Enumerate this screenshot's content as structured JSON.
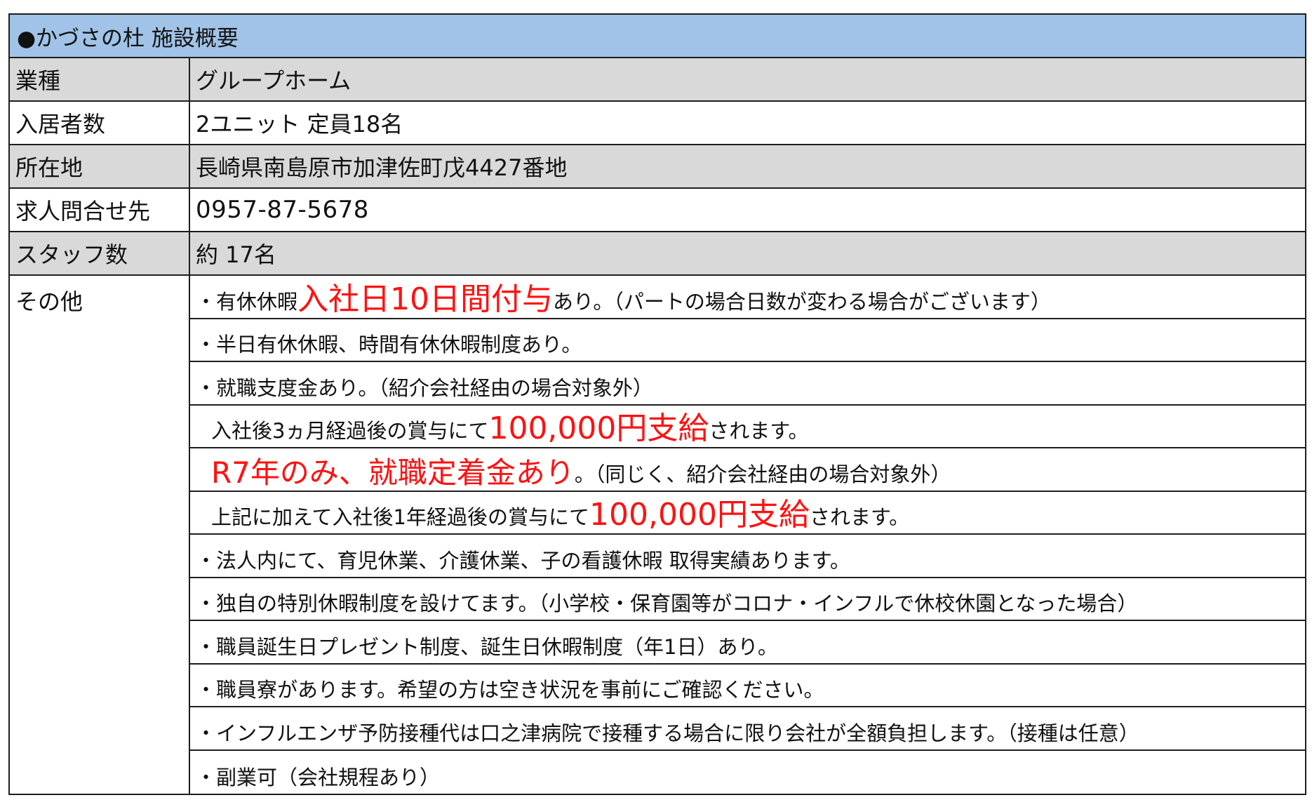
{
  "title": "●かづさの杜  施設概要",
  "rows": [
    {
      "label": "業種",
      "value": "グループホーム"
    },
    {
      "label": "入居者数",
      "value": "2ユニット  定員18名"
    },
    {
      "label": "所在地",
      "value": "長崎県南島原市加津佐町戊4427番地"
    },
    {
      "label": "求人問合せ先",
      "value": "0957-87-5678"
    },
    {
      "label": "スタッフ数",
      "value": "約  17名"
    }
  ],
  "other": {
    "label": "その他",
    "items": [
      {
        "pre": "・有休休暇",
        "em": "入社日10日間付与",
        "post": "あり。（パートの場合日数が変わる場合がございます）"
      },
      {
        "text": "・半日有休休暇、時間有休休暇制度あり。"
      },
      {
        "text": "・就職支度金あり。（紹介会社経由の場合対象外）"
      },
      {
        "pre": "入社後3ヵ月経過後の賞与にて",
        "em": "100,000円支給",
        "post": "されます。"
      },
      {
        "em": "R7年のみ、就職定着金あり",
        "post": "。（同じく、紹介会社経由の場合対象外）"
      },
      {
        "pre": "上記に加えて入社後1年経過後の賞与にて",
        "em": "100,000円支給",
        "post": "されます。"
      },
      {
        "text": "・法人内にて、育児休業、介護休業、子の看護休暇  取得実績あります。"
      },
      {
        "text": "・独自の特別休暇制度を設けてます。（小学校・保育園等がコロナ・インフルで休校休園となった場合）"
      },
      {
        "text": "・職員誕生日プレゼント制度、誕生日休暇制度（年1日）あり。"
      },
      {
        "text": "・職員寮があります。希望の方は空き状況を事前にご確認ください。"
      },
      {
        "text": "・インフルエンザ予防接種代は口之津病院で接種する場合に限り会社が全額負担します。（接種は任意）"
      },
      {
        "text": "・副業可（会社規程あり）"
      }
    ]
  },
  "colors": {
    "header_bg": "#a0c3e7",
    "shaded_row_bg": "#d9d9d9",
    "emphasis_text": "#ff1111",
    "border": "#1e1e1e"
  }
}
